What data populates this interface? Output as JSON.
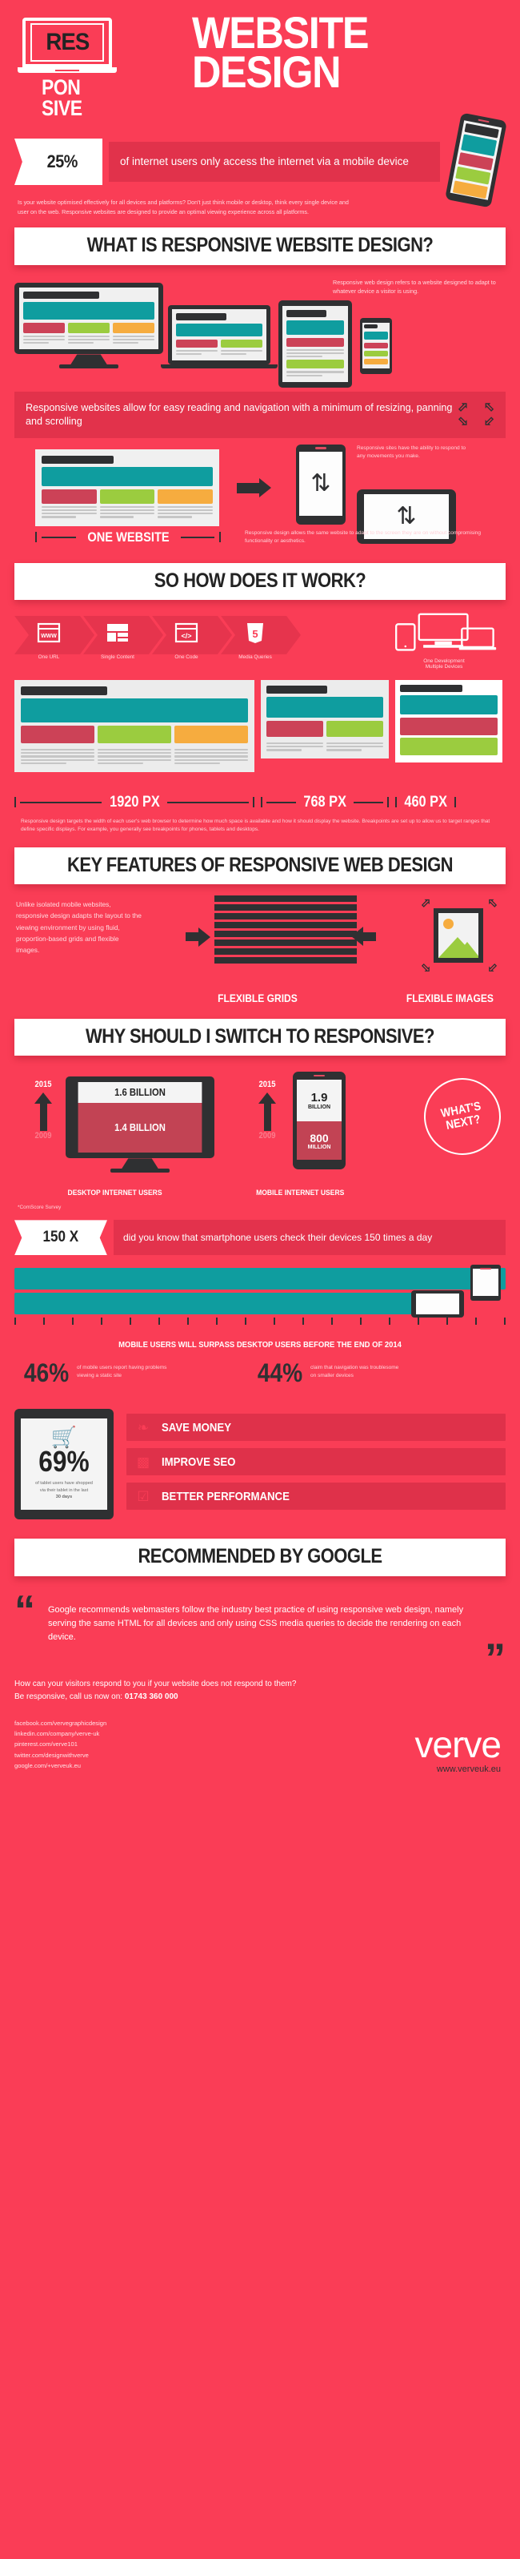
{
  "theme": {
    "bg": "#fa3d56",
    "dark": "#2f3032",
    "teal": "#0f9d9f",
    "red": "#cc4257",
    "green": "#9bcc3f",
    "amber": "#f6ac3f",
    "white": "#ffffff"
  },
  "header": {
    "logo_res": "RES",
    "logo_pon": "PON",
    "logo_sive": "SIVE",
    "title_line1": "WEBSITE",
    "title_line2": "DESIGN"
  },
  "stat_mobile": {
    "value": "25%",
    "text": "of internet users only access the internet via a mobile device",
    "intro": "Is your website optimised effectively for all devices and platforms? Don't just think mobile or desktop, think every single device and user on the web. Responsive websites are designed to provide an optimal viewing experience across all platforms."
  },
  "section_what": {
    "heading": "WHAT IS RESPONSIVE WEBSITE DESIGN?",
    "description": "Responsive web design refers to a website designed to adapt to whatever device a visitor is using.",
    "banner": "Responsive websites allow for easy reading and navigation with a minimum of resizing, panning and scrolling",
    "one_website_label": "ONE WEBSITE",
    "one_website_desc": "Responsive design allows the same website to adapt to the screen they are on without compromising functionality or aesthetics.",
    "respond_desc": "Responsive sites have the ability to respond to any movements you make."
  },
  "section_how": {
    "heading": "SO HOW DOES IT WORK?",
    "items": [
      {
        "icon": "www-browser-icon",
        "glyph": "WWW",
        "label": "One URL"
      },
      {
        "icon": "layout-content-icon",
        "glyph": "▤",
        "label": "Single Content"
      },
      {
        "icon": "code-brackets-icon",
        "glyph": "</>",
        "label": "One Code"
      },
      {
        "icon": "html5-shield-icon",
        "glyph": "5",
        "label": "Media Queries"
      }
    ],
    "devices_label_line1": "One Development",
    "devices_label_line2": "Multiple Devices",
    "breakpoints": [
      "1920 PX",
      "768 PX",
      "460 PX"
    ],
    "note": "Responsive design targets the width of each user's web browser to determine how much space is available and how it should display the website. Breakpoints are set up to allow us to target ranges that define specific displays. For example, you generally see breakpoints for phones, tablets and desktops."
  },
  "section_features": {
    "heading": "KEY FEATURES OF RESPONSIVE WEB DESIGN",
    "text": "Unlike isolated mobile websites, responsive design adapts the layout to the viewing environment by using fluid, proportion-based grids and flexible images.",
    "caption_left": "FLEXIBLE GRIDS",
    "caption_right": "FLEXIBLE IMAGES"
  },
  "section_why": {
    "heading": "WHY SHOULD I SWITCH TO RESPONSIVE?",
    "desktop": {
      "year_new": "2015",
      "year_old": "2009",
      "value_new": "1.6 BILLION",
      "value_old": "1.4 BILLION",
      "caption": "DESKTOP INTERNET USERS"
    },
    "mobile": {
      "year_new": "2015",
      "year_old": "2009",
      "value_new_num": "1.9",
      "value_new_unit": "BILLION",
      "value_old_num": "800",
      "value_old_unit": "MILLION",
      "caption": "MOBILE INTERNET USERS"
    },
    "whats_next_line1": "WHAT'S",
    "whats_next_line2": "NEXT?",
    "source": "*ComScore Survey"
  },
  "stat_150": {
    "value": "150 X",
    "text": "did you know that smartphone users check their devices 150 times a day",
    "surpass": "MOBILE USERS WILL SURPASS DESKTOP USERS BEFORE THE END OF 2014"
  },
  "stats_pct": [
    {
      "num": "46%",
      "caption": "of mobile users report having problems viewing a static site"
    },
    {
      "num": "44%",
      "caption": "claim that navigation was troublesome on smaller devices"
    }
  ],
  "tablet_stat": {
    "icon": "shopping-cart-icon",
    "value": "69%",
    "caption_line1": "of tablet users have shopped",
    "caption_line2": "via their tablet in the last",
    "caption_bold": "30 days"
  },
  "benefits": [
    {
      "icon": "hand-money-icon",
      "glyph": "❧",
      "label": "SAVE MONEY"
    },
    {
      "icon": "chart-growth-icon",
      "glyph": "ᵛ",
      "label": "IMPROVE SEO"
    },
    {
      "icon": "clipboard-check-icon",
      "glyph": "✓",
      "label": "BETTER PERFORMANCE"
    }
  ],
  "section_google": {
    "heading": "RECOMMENDED BY GOOGLE",
    "quote": "Google recommends webmasters follow the industry best practice of using responsive web design, namely serving the same HTML for all devices and only using CSS media queries to decide the rendering on each device.",
    "open_quote": "“",
    "close_quote": "”"
  },
  "footer": {
    "cta_line1": "How can your visitors respond to you if your website does not respond to them?",
    "cta_line2_pre": "Be responsive, call us now on: ",
    "phone": "01743 360 000",
    "social": [
      "facebook.com/vervegraphicdesign",
      "linkedin.com/company/verve-uk",
      "pinterest.com/verve101",
      "twitter.com/designwithverve",
      "google.com/+verveuk.eu"
    ],
    "brand": "verve",
    "url": "www.verveuk.eu"
  }
}
